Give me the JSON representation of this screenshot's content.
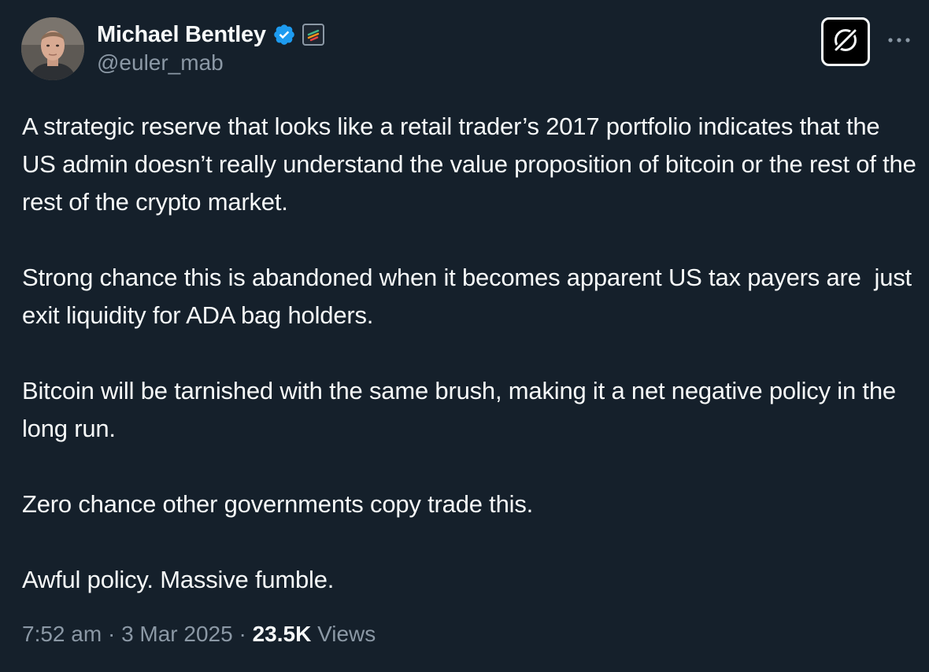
{
  "author": {
    "display_name": "Michael Bentley",
    "handle": "@euler_mab",
    "verified": true,
    "verified_color": "#1d9bf0"
  },
  "icons": {
    "verified": "verified-badge-icon",
    "affiliate": "affiliate-badge-icon",
    "grok": "grok-icon",
    "more": "more-icon"
  },
  "tweet": {
    "paragraphs": [
      "A strategic reserve that looks like a retail trader’s 2017 portfolio indicates that the US admin doesn’t really understand the value proposition of bitcoin or the rest of the rest of the crypto market.",
      "Strong chance this is abandoned when it becomes apparent US tax payers are  just exit liquidity for ADA bag holders.",
      "Bitcoin will be tarnished with the same brush, making it a net negative policy in the long run.",
      "Zero chance other governments copy trade this.",
      "Awful policy. Massive fumble."
    ]
  },
  "meta": {
    "time": "7:52 am",
    "separator": " · ",
    "date": "3 Mar 2025",
    "views_count": "23.5K",
    "views_label": " Views"
  },
  "colors": {
    "background": "#15202b",
    "text": "#f7f9f9",
    "secondary_text": "#8b98a5"
  }
}
